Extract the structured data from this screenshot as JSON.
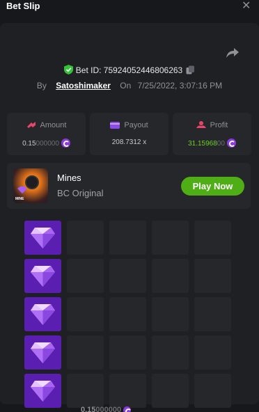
{
  "header": {
    "title": "Bet Slip",
    "close_glyph": "✕"
  },
  "bet": {
    "id_text": "Bet ID: 75924052446806263",
    "by_label": "By",
    "user": "Satoshimaker",
    "on_label": "On",
    "datetime": "7/25/2022, 3:07:16 PM"
  },
  "stats": {
    "amount": {
      "label": "Amount",
      "value_main": "0.15",
      "value_dim": "000000",
      "icon": "coin-icon"
    },
    "payout": {
      "label": "Payout",
      "value": "208.7312 x",
      "icon": "wallet-icon"
    },
    "profit": {
      "label": "Profit",
      "value_main": "31.15968",
      "value_dim": "00",
      "icon": "coin-icon"
    }
  },
  "game": {
    "name": "Mines",
    "subtitle": "BC Original",
    "thumb_tag": "MINE",
    "play_label": "Play Now"
  },
  "board": {
    "gem_column": 0,
    "rows_visible": 5,
    "columns": 5
  },
  "footer": {
    "amount_main": "0.15",
    "amount_dim": "000000"
  },
  "colors": {
    "accent_green": "#4fad16",
    "profit_green": "#6cd11e",
    "gem_purple": "#5a1fb0",
    "coin_purple": "#8b3bd9",
    "shield_green": "#35c23a"
  }
}
